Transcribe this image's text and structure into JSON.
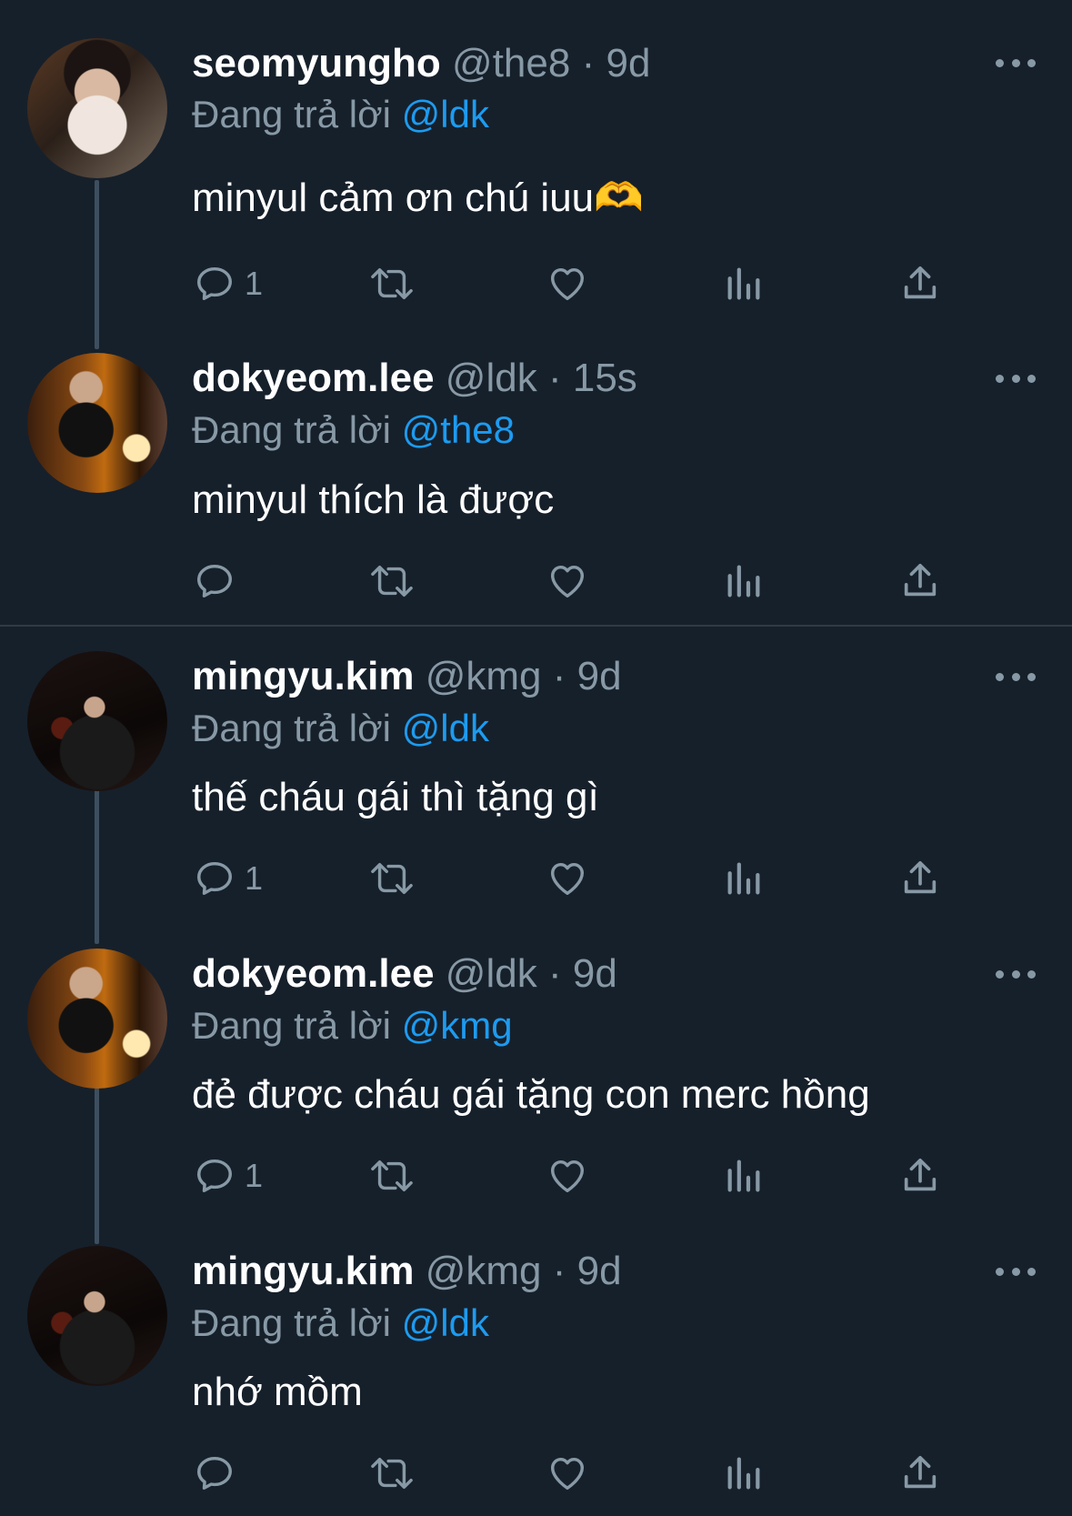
{
  "tweets": [
    {
      "name": "seomyungho",
      "handle": "@the8",
      "sep": "·",
      "time": "9d",
      "reply_prefix": "Đang trả lời",
      "reply_to": "@ldk",
      "text": " minyul cảm ơn chú iuu🫶",
      "reply_count": "1"
    },
    {
      "name": "dokyeom.lee",
      "handle": "@ldk",
      "sep": "·",
      "time": "15s",
      "reply_prefix": "Đang trả lời",
      "reply_to": "@the8",
      "text": "minyul thích là được",
      "reply_count": ""
    },
    {
      "name": "mingyu.kim",
      "handle": "@kmg",
      "sep": "·",
      "time": "9d",
      "reply_prefix": "Đang trả lời",
      "reply_to": "@ldk",
      "text": "thế cháu gái thì tặng gì",
      "reply_count": "1"
    },
    {
      "name": "dokyeom.lee",
      "handle": "@ldk",
      "sep": "·",
      "time": "9d",
      "reply_prefix": "Đang trả lời",
      "reply_to": "@kmg",
      "text": "đẻ được cháu gái tặng con merc hồng",
      "reply_count": "1"
    },
    {
      "name": "mingyu.kim",
      "handle": "@kmg",
      "sep": "·",
      "time": "9d",
      "reply_prefix": "Đang trả lời",
      "reply_to": "@ldk",
      "text": "nhớ mồm",
      "reply_count": ""
    }
  ],
  "icons": {
    "reply": "reply-icon",
    "retweet": "retweet-icon",
    "like": "like-icon",
    "views": "views-icon",
    "share": "share-icon",
    "more": "more-icon"
  },
  "colors": {
    "background": "#16202b",
    "secondary_text": "#8899a6",
    "mention": "#1d9bf0",
    "thread_line": "#3d4e5f"
  }
}
